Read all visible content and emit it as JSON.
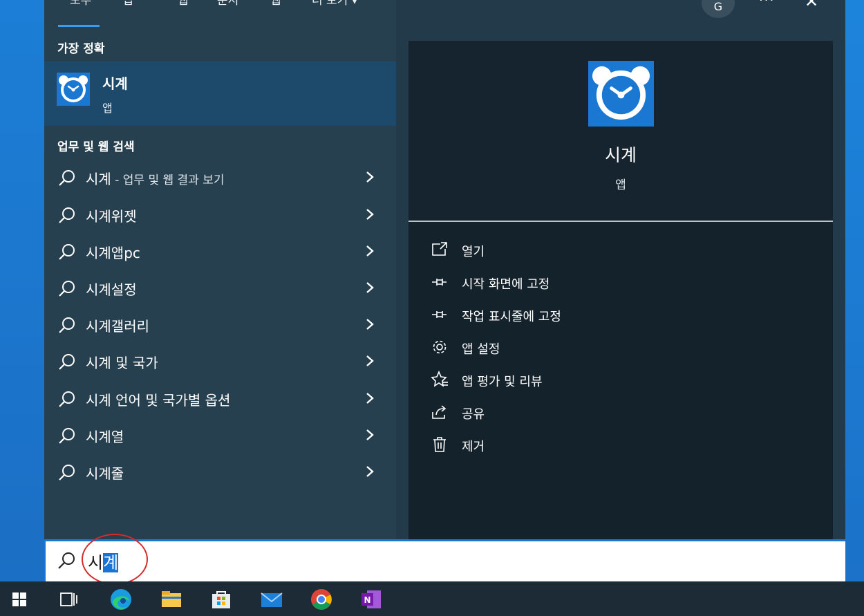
{
  "top_tabs": [
    "모두",
    "앱",
    "웹",
    "문서",
    "웹",
    "더 보기"
  ],
  "avatar_letter": "G",
  "best_match": {
    "header": "가장 정확",
    "title": "시계",
    "type": "앱"
  },
  "web_search": {
    "header": "업무 및 웹 검색",
    "suggestions": [
      {
        "main": "시계",
        "suffix": " - 업무 및 웹 결과 보기"
      },
      {
        "main": "시계위젯",
        "suffix": ""
      },
      {
        "main": "시계앱pc",
        "suffix": ""
      },
      {
        "main": "시계설정",
        "suffix": ""
      },
      {
        "main": "시계갤러리",
        "suffix": ""
      },
      {
        "main": "시계 및 국가",
        "suffix": ""
      },
      {
        "main": "시계 언어 및 국가별 옵션",
        "suffix": ""
      },
      {
        "main": "시계열",
        "suffix": ""
      },
      {
        "main": "시계줄",
        "suffix": ""
      }
    ]
  },
  "preview": {
    "title": "시계",
    "type": "앱",
    "actions": [
      {
        "label": "열기",
        "icon": "open-icon"
      },
      {
        "label": "시작 화면에 고정",
        "icon": "pin-icon"
      },
      {
        "label": "작업 표시줄에 고정",
        "icon": "pin-icon"
      },
      {
        "label": "앱 설정",
        "icon": "gear-icon"
      },
      {
        "label": "앱 평가 및 리뷰",
        "icon": "star-icon"
      },
      {
        "label": "공유",
        "icon": "share-icon"
      },
      {
        "label": "제거",
        "icon": "trash-icon"
      }
    ]
  },
  "search": {
    "typed": "시",
    "selected": "계"
  },
  "colors": {
    "accent": "#1a74d6",
    "left_pane": "#27404f",
    "best_match_bg": "#1d4a6a",
    "preview_bg": "#14222c",
    "annotation": "#d42a2a"
  },
  "taskbar": [
    "windows-start-icon",
    "task-view-icon",
    "edge-icon",
    "file-explorer-icon",
    "store-icon",
    "mail-icon",
    "chrome-icon",
    "onenote-icon"
  ]
}
